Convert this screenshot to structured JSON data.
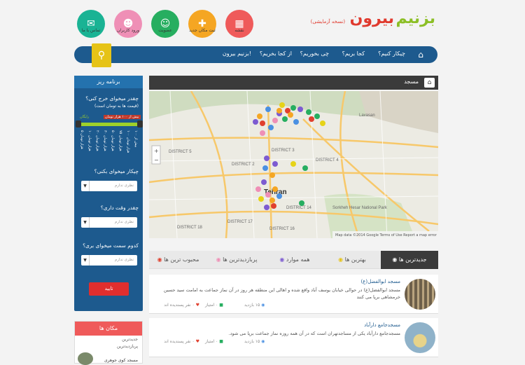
{
  "header": {
    "logo_word1": "بزنیم",
    "logo_word2": "بیرون",
    "logo_sub": "(نسخه آزمایشی)",
    "icons": [
      {
        "label": "نقشه",
        "color": "#ef5a5a",
        "icon": "map-icon"
      },
      {
        "label": "ثبت مکان جدید",
        "color": "#f5a623",
        "icon": "add-place-icon"
      },
      {
        "label": "عضویت",
        "color": "#27ae60",
        "icon": "user-add-icon"
      },
      {
        "label": "ورود کاربران",
        "color": "#ef8fb6",
        "icon": "user-login-icon"
      },
      {
        "label": "تماس با ما",
        "color": "#1ab394",
        "icon": "mail-icon"
      }
    ]
  },
  "nav": {
    "items": [
      "چیکار کنیم؟",
      "کجا بریم؟",
      "چی بخوریم؟",
      "از کجا بخریم؟",
      "بزنیم بیرون!"
    ]
  },
  "sidebar": {
    "title": "برنامه ریز",
    "q_budget": "چقدر میخوای خرج کنی؟",
    "q_budget_sub": "(قیمت ها به تومان است)",
    "slider_left": "رایگان",
    "slider_right": "بیش از ۱۰۰ هزار تومان",
    "ticks": [
      "۵ هزار تومان",
      "۱۰ هزار تومان",
      "۲۰ هزار تومان",
      "۳۰ هزار تومان",
      "۵۰ هزار تومان",
      "۷۵ هزار تومان",
      "۱۰۰ هزار تومان",
      "بیش از ۱۰۰"
    ],
    "q_what": "چیکار میخوای بکنی؟",
    "q_time": "چقدر وقت داری؟",
    "q_direction": "کدوم سمت میخوای بری؟",
    "select_placeholder": "نظری ندارم",
    "submit": "تایید"
  },
  "places": {
    "title": "مکان ها",
    "rows": [
      "جدیدترین",
      "پربازدیدترین"
    ],
    "item1": "مسجد کوی جوهری"
  },
  "main": {
    "title": "مسجد",
    "map_labels": {
      "district5": "DISTRICT 5",
      "district2": "DISTRICT 2",
      "district3": "DISTRICT 3",
      "district4": "DISTRICT 4",
      "district14": "DISTRICT 14",
      "district17": "DISTRICT 17",
      "district16": "DISTRICT 16",
      "district18": "DISTRICT 18",
      "tehran": "Tehran",
      "lavasan": "Lavasan",
      "park": "Sorkheh Hesar National Park",
      "footer": "Map data ©2014 Google   Terms of Use   Report a map error"
    },
    "tabs": [
      "جدیدترین ها",
      "بهترین ها",
      "همه موارد",
      "پربازدیدترین ها",
      "محبوب ترین ها"
    ],
    "items": [
      {
        "title": "مسجد ابوالفضل(ع)",
        "desc": "مسجد ابوالفضل(ع) در حوالی خیابان یوسف آباد واقع شده و اهالی این منطقه هر روز در آن نماز جماعت به امامت سید حسین خرمشاهی برپا می کنند",
        "views": "۱۵ بازدید",
        "score": "۰ امتیاز",
        "likes": "۰ نفر پسندیده اند"
      },
      {
        "title": "مسجدجامع دارآباد",
        "desc": "مسجدجامع دارآباد یکی از مساجدتهران است که در آن همه روزه نماز جماعت برپا می شود.",
        "views": "۱۵ بازدید",
        "score": "۰ امتیاز",
        "likes": "۰ نفر پسندیده اند"
      }
    ]
  }
}
